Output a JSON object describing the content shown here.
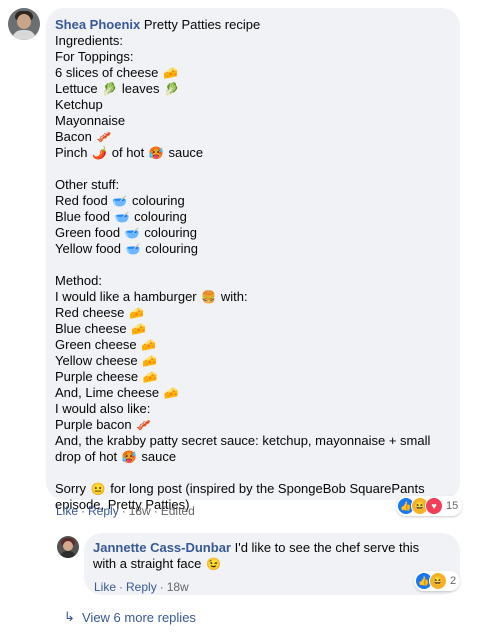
{
  "comment": {
    "author": "Shea Phoenix",
    "first_line": "Pretty Patties recipe",
    "lines": [
      [
        "Ingredients:"
      ],
      [
        "For Toppings:"
      ],
      [
        "6 slices of cheese",
        "🧀",
        ""
      ],
      [
        "Lettuce",
        "🥬",
        "leaves",
        "🥬"
      ],
      [
        "Ketchup"
      ],
      [
        "Mayonnaise"
      ],
      [
        "Bacon",
        "🥓",
        ""
      ],
      [
        "Pinch",
        "🌶️",
        "of hot",
        "🥵",
        "sauce"
      ],
      [
        ""
      ],
      [
        "Other stuff:"
      ],
      [
        "Red food",
        "🥣",
        "colouring"
      ],
      [
        "Blue food",
        "🥣",
        "colouring"
      ],
      [
        "Green food",
        "🥣",
        "colouring"
      ],
      [
        "Yellow food",
        "🥣",
        "colouring"
      ],
      [
        ""
      ],
      [
        "Method:"
      ],
      [
        "I would like a hamburger",
        "🍔",
        "with:"
      ],
      [
        "Red cheese",
        "🧀",
        ""
      ],
      [
        "Blue cheese",
        "🧀",
        ""
      ],
      [
        "Green cheese",
        "🧀",
        ""
      ],
      [
        "Yellow cheese",
        "🧀",
        ""
      ],
      [
        "Purple cheese",
        "🧀",
        ""
      ],
      [
        "And, Lime cheese",
        "🧀",
        ""
      ],
      [
        "I would also like:"
      ],
      [
        "Purple bacon",
        "🥓",
        ""
      ],
      [
        "And, the krabby patty secret sauce: ketchup, mayonnaise + small"
      ],
      [
        "drop of hot",
        "🥵",
        "sauce"
      ],
      [
        ""
      ],
      [
        "Sorry",
        "😐",
        "for long post (inspired by the SpongeBob SquarePants"
      ],
      [
        "episode, Pretty Patties)"
      ]
    ],
    "actions": {
      "like": "Like",
      "reply": "Reply",
      "time": "18w",
      "edited": "Edited"
    },
    "reactions": {
      "icons": [
        "like-icon",
        "haha-icon",
        "love-icon"
      ],
      "count": "15"
    }
  },
  "reply": {
    "author": "Jannette Cass-Dunbar",
    "text_line1": "I'd like to see the chef serve this",
    "text_line2": "with a straight face",
    "emoji": "😉",
    "actions": {
      "like": "Like",
      "reply": "Reply",
      "time": "18w"
    },
    "reactions": {
      "icons": [
        "like-icon",
        "haha-icon"
      ],
      "count": "2"
    }
  },
  "view_more": {
    "label": "View 6 more replies"
  },
  "colors": {
    "link": "#385898",
    "bubble": "#f0f2f5",
    "meta": "#65676b"
  }
}
